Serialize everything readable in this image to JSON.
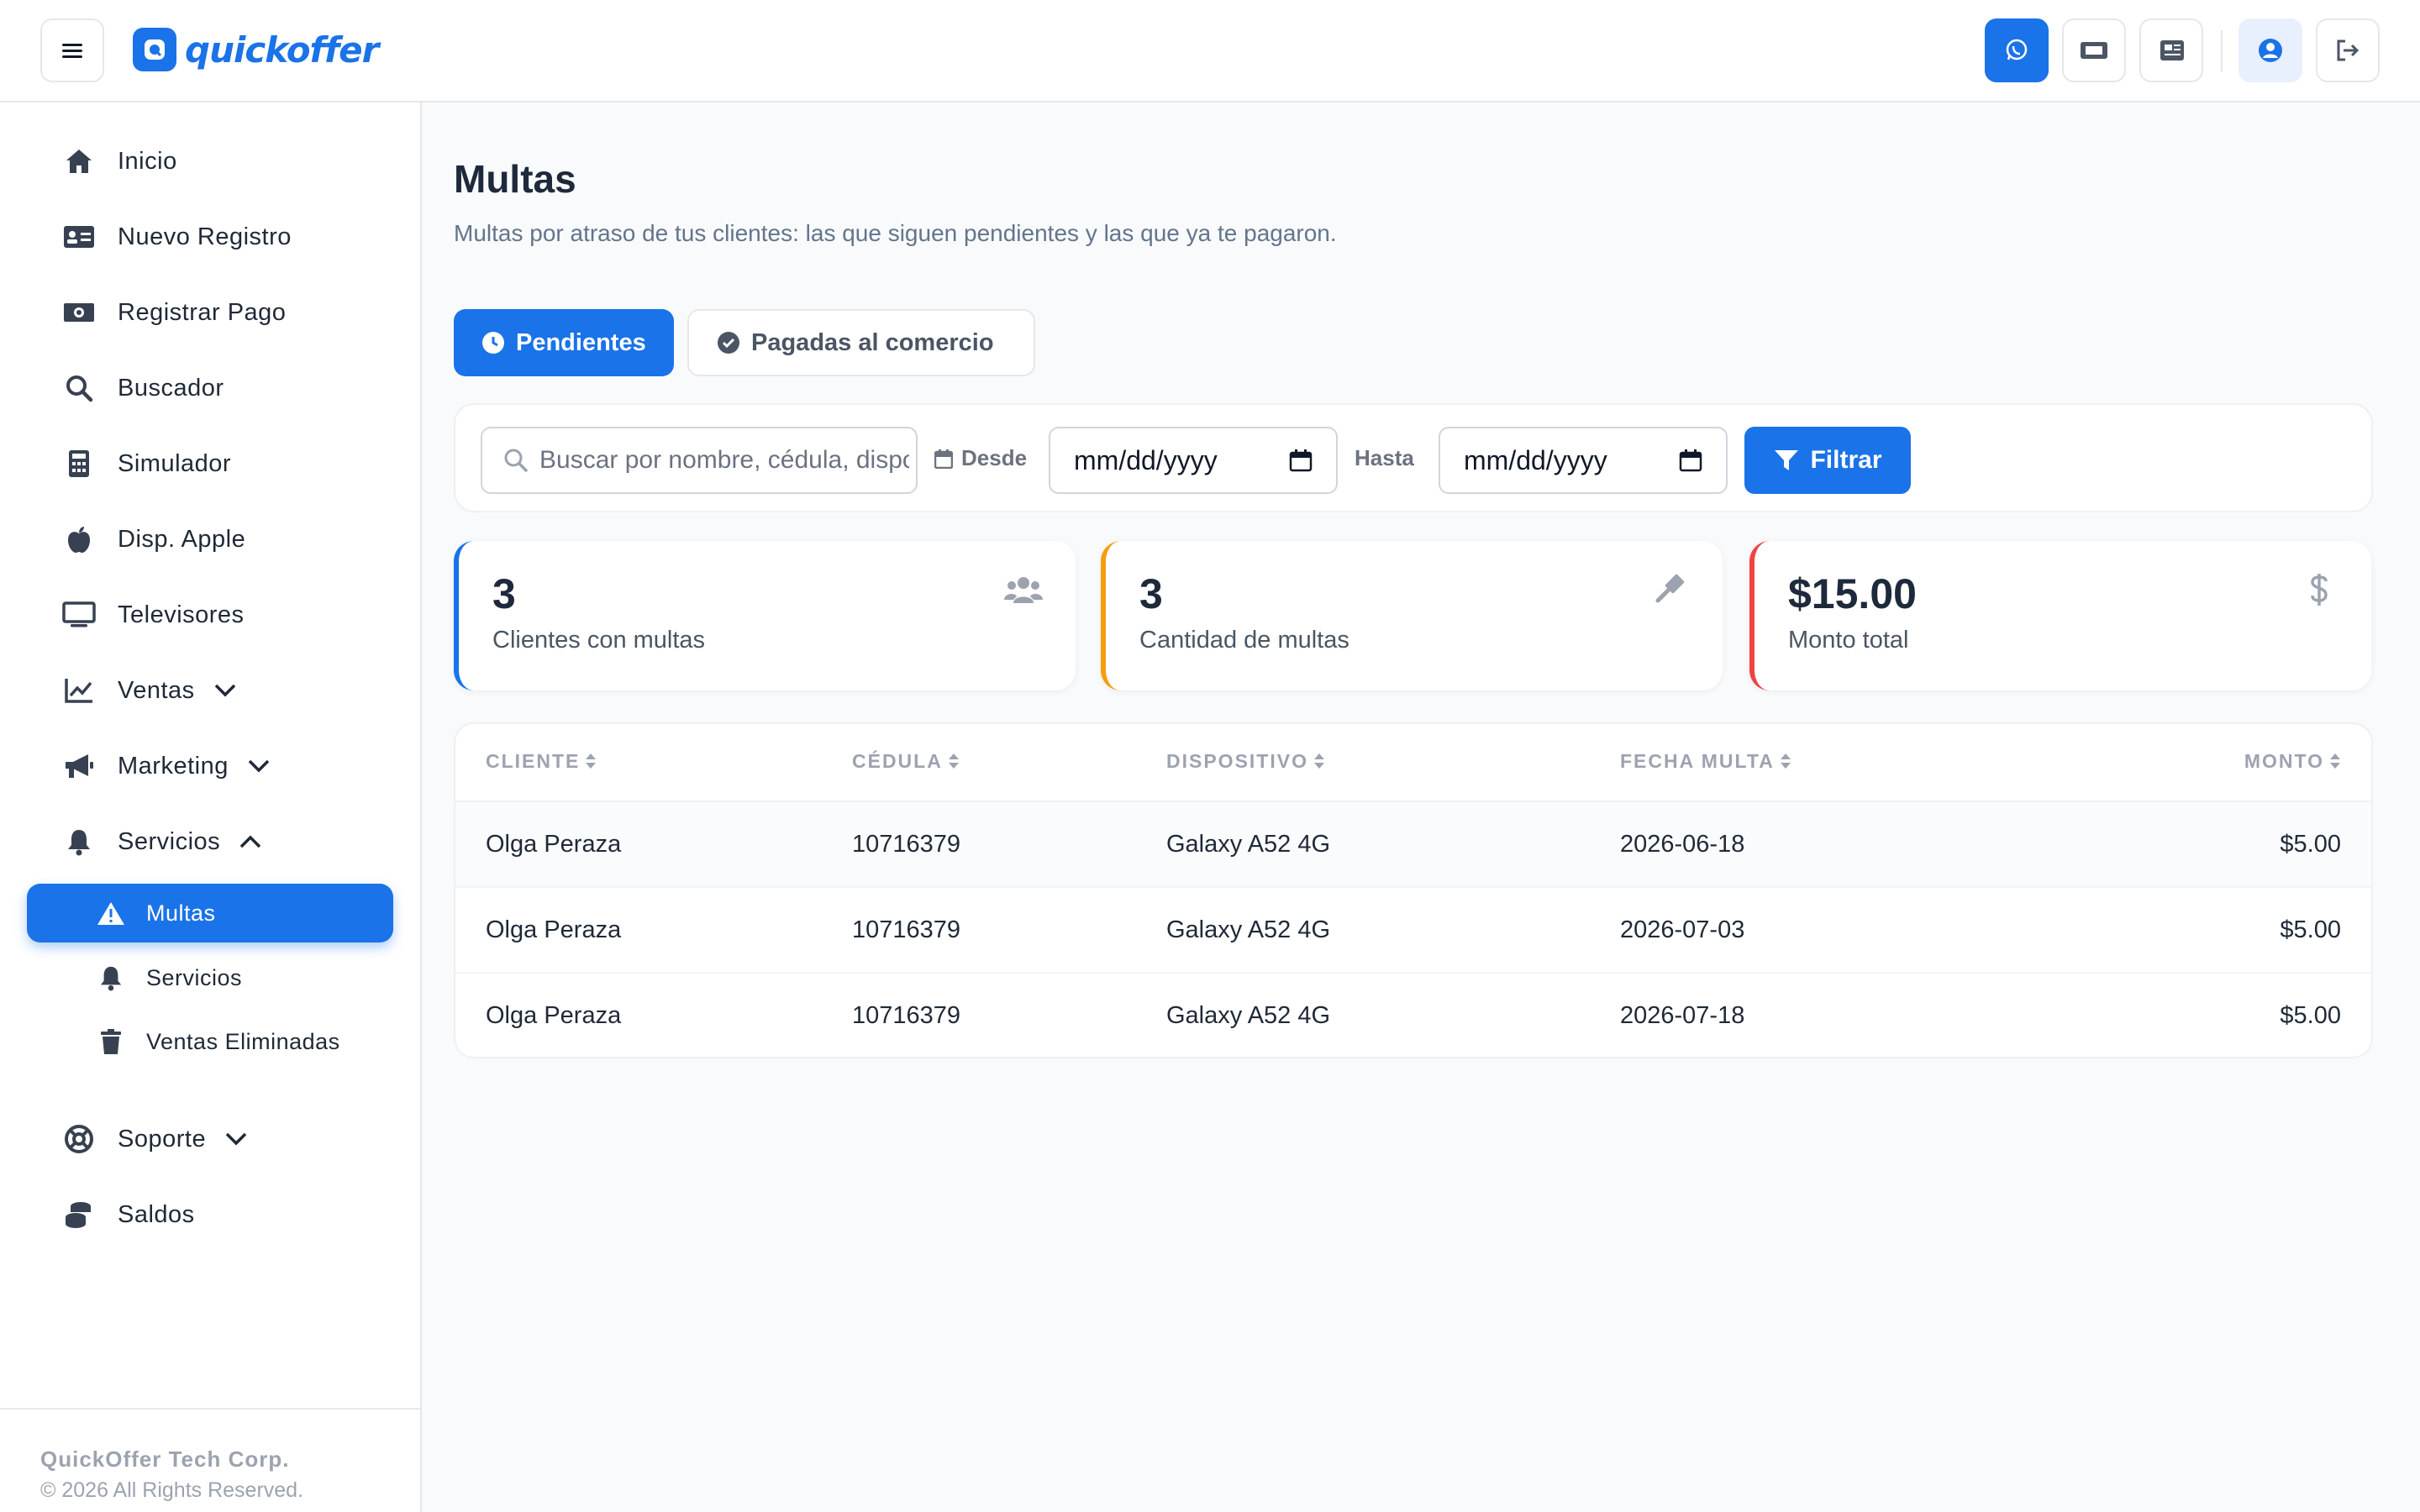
{
  "app": {
    "brand": "quickoffer"
  },
  "header": {
    "buttons": [
      "whatsapp-icon",
      "ticket-icon",
      "newspaper-icon",
      "user-circle-icon",
      "logout-icon"
    ]
  },
  "sidebar": {
    "items": [
      {
        "label": "Inicio",
        "icon": "home-icon"
      },
      {
        "label": "Nuevo Registro",
        "icon": "id-card-icon"
      },
      {
        "label": "Registrar Pago",
        "icon": "money-bill-icon"
      },
      {
        "label": "Buscador",
        "icon": "search-icon"
      },
      {
        "label": "Simulador",
        "icon": "calculator-icon"
      },
      {
        "label": "Disp. Apple",
        "icon": "apple-icon"
      },
      {
        "label": "Televisores",
        "icon": "monitor-icon"
      },
      {
        "label": "Ventas",
        "icon": "chart-line-icon"
      },
      {
        "label": "Marketing",
        "icon": "megaphone-icon"
      },
      {
        "label": "Servicios",
        "icon": "bell-icon"
      },
      {
        "label": "Soporte",
        "icon": "life-ring-icon"
      },
      {
        "label": "Saldos",
        "icon": "coins-icon"
      }
    ],
    "sub_items": [
      {
        "label": "Multas",
        "icon": "warning-icon",
        "active": true
      },
      {
        "label": "Servicios",
        "icon": "bell-icon"
      },
      {
        "label": "Ventas Eliminadas",
        "icon": "trash-icon"
      }
    ],
    "footer": {
      "company": "QuickOffer Tech Corp.",
      "rights": "© 2026 All Rights Reserved."
    }
  },
  "page": {
    "title": "Multas",
    "subtitle": "Multas por atraso de tus clientes: las que siguen pendientes y las que ya te pagaron."
  },
  "tabs": [
    {
      "label": "Pendientes",
      "active": true
    },
    {
      "label": "Pagadas al comercio",
      "active": false
    }
  ],
  "filters": {
    "search_placeholder": "Buscar por nombre, cédula, dispositivo...",
    "desde_label": "Desde",
    "hasta_label": "Hasta",
    "desde_value": "mm/dd/yyyy",
    "hasta_value": "mm/dd/yyyy",
    "filter_button": "Filtrar"
  },
  "stats": [
    {
      "value": "3",
      "label": "Clientes con multas",
      "icon": "users-icon",
      "color": "#1a73e8"
    },
    {
      "value": "3",
      "label": "Cantidad de multas",
      "icon": "gavel-icon",
      "color": "#f59e0b"
    },
    {
      "value": "$15.00",
      "label": "Monto total",
      "icon": "dollar-icon",
      "color": "#ef4444"
    }
  ],
  "table": {
    "columns": [
      "CLIENTE",
      "CÉDULA",
      "DISPOSITIVO",
      "FECHA MULTA",
      "MONTO"
    ],
    "rows": [
      [
        "Olga Peraza",
        "10716379",
        "Galaxy A52 4G",
        "2026-06-18",
        "$5.00"
      ],
      [
        "Olga Peraza",
        "10716379",
        "Galaxy A52 4G",
        "2026-07-03",
        "$5.00"
      ],
      [
        "Olga Peraza",
        "10716379",
        "Galaxy A52 4G",
        "2026-07-18",
        "$5.00"
      ]
    ]
  },
  "colors": {
    "primary": "#1a73e8",
    "warning": "#f59e0b",
    "danger": "#ef4444"
  }
}
